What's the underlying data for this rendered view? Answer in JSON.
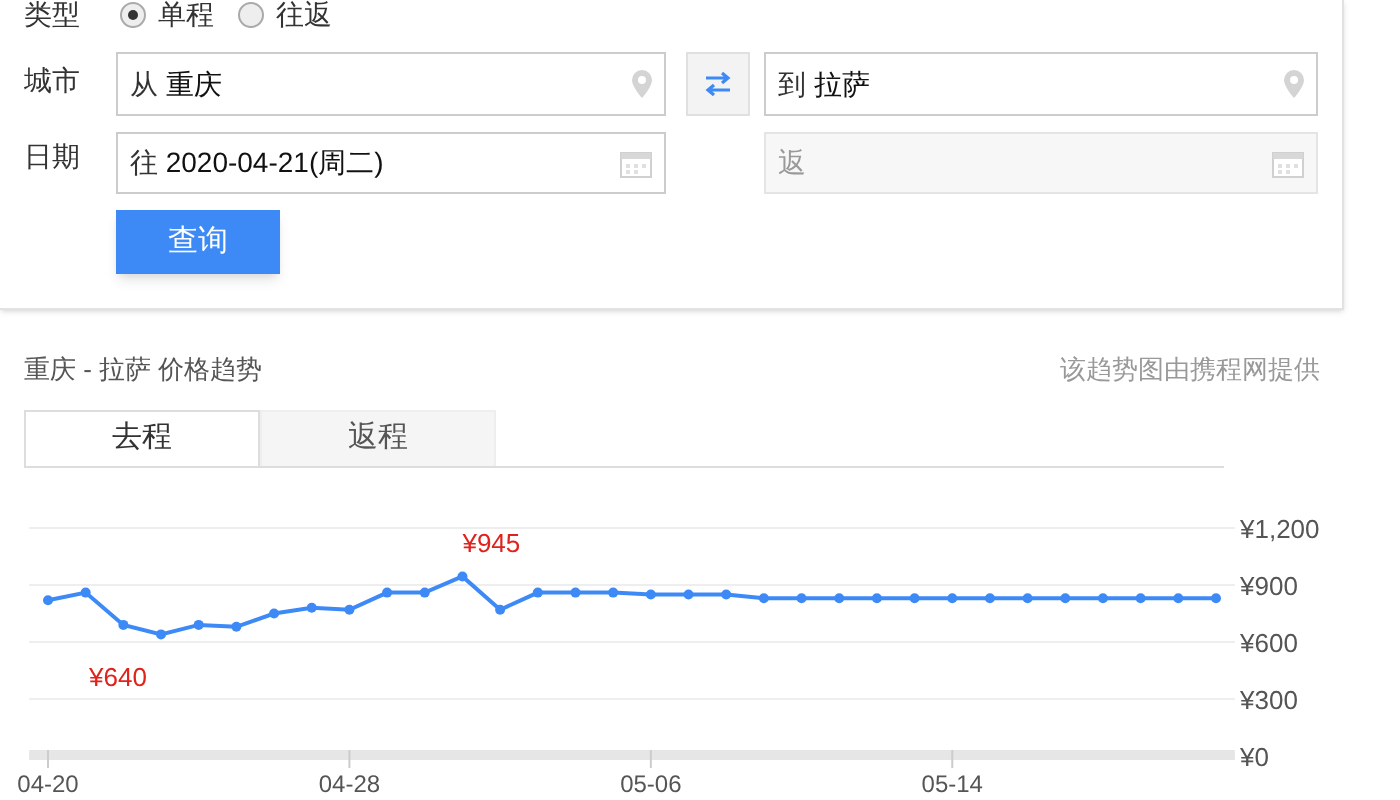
{
  "form": {
    "type_label": "类型",
    "trip_options": [
      {
        "label": "单程",
        "selected": true
      },
      {
        "label": "往返",
        "selected": false
      }
    ],
    "city_label": "城市",
    "from_prefix": "从",
    "from_value": "重庆",
    "to_prefix": "到",
    "to_value": "拉萨",
    "date_label": "日期",
    "depart_prefix": "往",
    "depart_value": "2020-04-21(周二)",
    "return_placeholder": "返",
    "return_disabled": true,
    "search_button": "查询"
  },
  "trend": {
    "title": "重庆 - 拉萨 价格趋势",
    "source_note": "该趋势图由携程网提供",
    "tabs": [
      {
        "label": "去程",
        "selected": true
      },
      {
        "label": "返程",
        "selected": false
      }
    ],
    "chart_data": {
      "type": "line",
      "grid": true,
      "categories": [
        "04-20",
        null,
        null,
        null,
        null,
        null,
        null,
        null,
        "04-28",
        null,
        null,
        null,
        null,
        null,
        null,
        null,
        "05-06",
        null,
        null,
        null,
        null,
        null,
        null,
        null,
        "05-14",
        null,
        null,
        null,
        null,
        null,
        null,
        null
      ],
      "series": [
        {
          "color": "#3d8af7",
          "marker": "circle",
          "values": [
            820,
            860,
            690,
            640,
            690,
            680,
            750,
            780,
            770,
            860,
            860,
            945,
            770,
            860,
            860,
            860,
            850,
            850,
            850,
            830,
            830,
            830,
            830,
            830,
            830,
            830,
            830,
            830,
            830,
            830,
            830,
            830
          ]
        }
      ],
      "ylim": [
        0,
        1200
      ],
      "yticks": [
        {
          "value": 0,
          "label": "¥0"
        },
        {
          "value": 300,
          "label": "¥300"
        },
        {
          "value": 600,
          "label": "¥600"
        },
        {
          "value": 900,
          "label": "¥900"
        },
        {
          "value": 1200,
          "label": "¥1,200"
        }
      ],
      "annotations": [
        "¥945",
        "¥640"
      ]
    }
  }
}
